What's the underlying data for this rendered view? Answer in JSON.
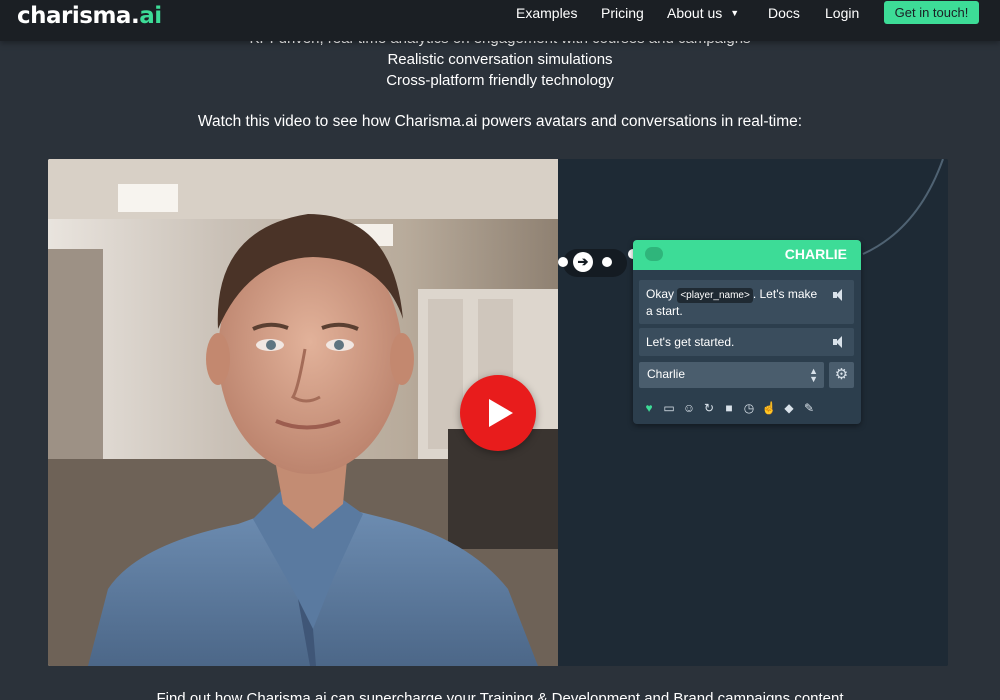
{
  "header": {
    "logo_main": "charisma",
    "logo_dot": ".",
    "logo_ai": "ai",
    "nav": {
      "examples": "Examples",
      "pricing": "Pricing",
      "about": "About us",
      "docs": "Docs",
      "login": "Login"
    },
    "cta": "Get in touch!"
  },
  "intro": {
    "line0": "KPI-driven, real-time analytics on engagement with courses and campaigns",
    "line1": "Realistic conversation simulations",
    "line2": "Cross-platform friendly technology",
    "watch": "Watch this video to see how Charisma.ai powers avatars and conversations in real-time:"
  },
  "video": {
    "node_title": "CHARLIE",
    "line1_before": "Okay ",
    "line1_tag": "<player_name>",
    "line1_after": ". Let's make a start.",
    "line2": "Let's get started.",
    "character_select": "Charlie"
  },
  "bottom_text": "Find out how Charisma.ai can supercharge your Training & Development and Brand campaigns content",
  "colors": {
    "accent": "#3ddc97",
    "header_bg": "#1b1f24",
    "page_bg": "#2b323a",
    "play_red": "#e81c1c"
  }
}
